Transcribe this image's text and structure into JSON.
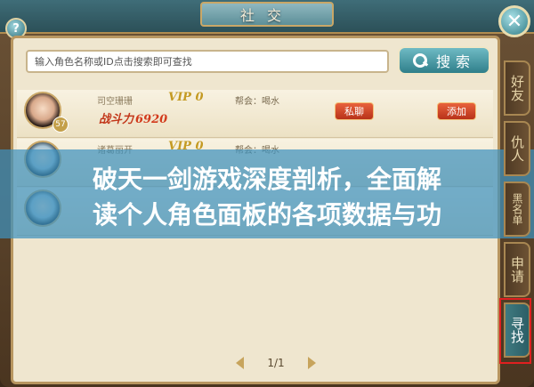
{
  "window": {
    "title": "社交"
  },
  "controls": {
    "help_label": "?",
    "close_label": "✕"
  },
  "search": {
    "placeholder": "输入角色名称或ID点击搜索即可查找",
    "button_label": "搜索"
  },
  "friends": [
    {
      "name": "司空珊珊",
      "vip": "VIP 0",
      "guild": "帮会：喝水",
      "power_label": "战斗力",
      "power": "6920",
      "level": "57",
      "pm_label": "私聊",
      "add_label": "添加"
    },
    {
      "name": "诸葛丽开",
      "vip": "VIP 0",
      "guild": "帮会：喝水",
      "power_label": "",
      "power": "",
      "level": "",
      "pm_label": "",
      "add_label": ""
    },
    {
      "name": "",
      "vip": "",
      "guild": "",
      "power_label": "",
      "power": "",
      "level": "",
      "pm_label": "",
      "add_label": ""
    }
  ],
  "banner": {
    "line1": "破天一剑游戏深度剖析，全面解",
    "line2": "读个人角色面板的各项数据与功"
  },
  "pager": {
    "text": "1/1"
  },
  "side_tabs": [
    {
      "label": "好友",
      "active": false
    },
    {
      "label": "仇人",
      "active": false
    },
    {
      "label": "黑名单",
      "active": false
    },
    {
      "label": "申请",
      "active": false
    },
    {
      "label": "寻找",
      "active": true
    }
  ],
  "colors": {
    "accent": "#2f7f8a",
    "action_red": "#b8321a",
    "banner": "#3e91be",
    "highlight": "#e02020"
  }
}
